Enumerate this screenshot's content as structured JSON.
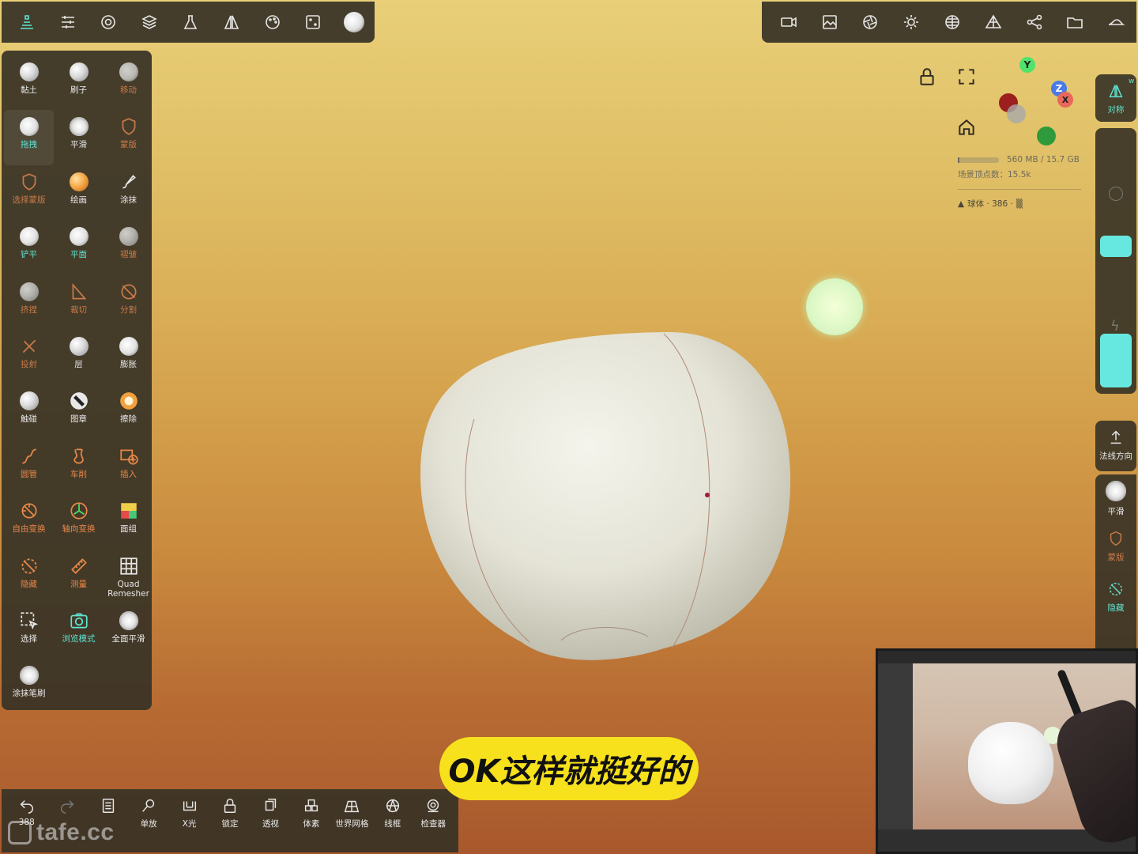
{
  "top_toolbar_left": [
    {
      "icon": "layers-stack-icon"
    },
    {
      "icon": "sliders-icon"
    },
    {
      "icon": "settings-gear-icon"
    },
    {
      "icon": "layers-icon"
    },
    {
      "icon": "flask-icon"
    },
    {
      "icon": "symmetry-icon"
    },
    {
      "icon": "palette-icon"
    },
    {
      "icon": "dice-icon"
    },
    {
      "icon": "sphere-tool-icon"
    }
  ],
  "top_toolbar_right": [
    {
      "icon": "camera-video-icon"
    },
    {
      "icon": "image-icon"
    },
    {
      "icon": "aperture-icon"
    },
    {
      "icon": "sun-icon"
    },
    {
      "icon": "globe-grid-icon"
    },
    {
      "icon": "mesh-pyramid-icon"
    },
    {
      "icon": "share-nodes-icon"
    },
    {
      "icon": "folder-icon"
    },
    {
      "icon": "hat-icon"
    }
  ],
  "tools": [
    {
      "label": "黏土",
      "style": "normal",
      "icon": "ball"
    },
    {
      "label": "刷子",
      "style": "normal",
      "icon": "ball"
    },
    {
      "label": "移动",
      "style": "dim",
      "icon": "moon"
    },
    {
      "label": "拖拽",
      "style": "teal-active",
      "icon": "moon"
    },
    {
      "label": "平滑",
      "style": "normal",
      "icon": "spike"
    },
    {
      "label": "蒙版",
      "style": "dim",
      "icon": "shield"
    },
    {
      "label": "选择蒙版",
      "style": "dim",
      "icon": "shield"
    },
    {
      "label": "绘画",
      "style": "normal",
      "icon": "orange"
    },
    {
      "label": "涂抹",
      "style": "normal",
      "icon": "brush"
    },
    {
      "label": "铲平",
      "style": "teal",
      "icon": "moon"
    },
    {
      "label": "平面",
      "style": "teal",
      "icon": "moon"
    },
    {
      "label": "褶皱",
      "style": "dim",
      "icon": "ball"
    },
    {
      "label": "挤捏",
      "style": "dim",
      "icon": "ball"
    },
    {
      "label": "裁切",
      "style": "dim",
      "icon": "cut"
    },
    {
      "label": "分割",
      "style": "dim",
      "icon": "split"
    },
    {
      "label": "投射",
      "style": "dim",
      "icon": "project"
    },
    {
      "label": "层",
      "style": "normal",
      "icon": "ball"
    },
    {
      "label": "膨胀",
      "style": "normal",
      "icon": "moon"
    },
    {
      "label": "触碰",
      "style": "normal",
      "icon": "ball"
    },
    {
      "label": "图章",
      "style": "normal",
      "icon": "stamp"
    },
    {
      "label": "擦除",
      "style": "normal",
      "icon": "erase"
    },
    {
      "label": "圆管",
      "style": "orange",
      "icon": "tube"
    },
    {
      "label": "车削",
      "style": "orange",
      "icon": "lathe"
    },
    {
      "label": "插入",
      "style": "orange",
      "icon": "insert"
    },
    {
      "label": "自由变换",
      "style": "orange",
      "icon": "free"
    },
    {
      "label": "轴向变换",
      "style": "orange",
      "icon": "axis"
    },
    {
      "label": "面组",
      "style": "normal",
      "icon": "facegroup"
    },
    {
      "label": "隐藏",
      "style": "orange",
      "icon": "hide"
    },
    {
      "label": "测量",
      "style": "orange",
      "icon": "ruler"
    },
    {
      "label": "Quad Remesher",
      "style": "normal",
      "icon": "grid"
    },
    {
      "label": "选择",
      "style": "normal",
      "icon": "select"
    },
    {
      "label": "浏览模式",
      "style": "teal",
      "icon": "camera"
    },
    {
      "label": "全面平滑",
      "style": "normal",
      "icon": "spike"
    },
    {
      "label": "涂抹笔刷",
      "style": "normal",
      "icon": "spike"
    }
  ],
  "bottom_toolbar": [
    {
      "label": "388",
      "icon": "undo-icon"
    },
    {
      "label": "",
      "icon": "redo-icon"
    },
    {
      "label": "",
      "icon": "layer-list-icon"
    },
    {
      "label": "单放",
      "icon": "search-icon"
    },
    {
      "label": "X光",
      "icon": "xray-icon"
    },
    {
      "label": "锁定",
      "icon": "lock-icon"
    },
    {
      "label": "透视",
      "icon": "perspective-icon"
    },
    {
      "label": "体素",
      "icon": "voxel-icon"
    },
    {
      "label": "世界网格",
      "icon": "world-grid-icon"
    },
    {
      "label": "线框",
      "icon": "wireframe-icon"
    },
    {
      "label": "检查器",
      "icon": "inspector-icon"
    }
  ],
  "watermark": "tafe.cc",
  "scene_info": {
    "memory": "560 MB / 15.7 GB",
    "vertex_count": "场景顶点数：15.5k",
    "object": "球体 · 386 ·"
  },
  "gizmo": {
    "y_label": "Y",
    "z_label": "Z",
    "x_label": "X"
  },
  "right_panel": {
    "symmetry_label": "对称",
    "symmetry_w": "w",
    "normal_dir_label": "法线方向",
    "smooth_label": "平滑",
    "mask_label": "蒙版",
    "hide_label": "隐藏"
  },
  "sliders": {
    "radius_fraction": 0.1,
    "intensity_fraction": 0.3
  },
  "subtitle": "OK这样就挺好的",
  "colors": {
    "accent_teal": "#5fe3d2",
    "dim_orange": "#c87a4a",
    "subtitle_bg": "#f7e01c",
    "panel_bg": "#3a3426"
  }
}
